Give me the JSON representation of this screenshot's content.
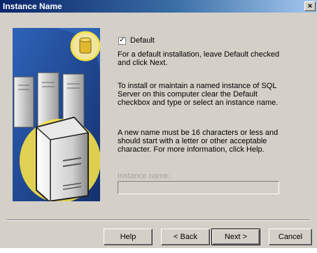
{
  "window": {
    "title": "Instance Name",
    "close_glyph": "×"
  },
  "default_checkbox": {
    "label": "Default",
    "checked": true,
    "check_glyph": "✓"
  },
  "paragraphs": {
    "default_install": "For a default installation, leave Default checked and click Next.",
    "named_instance": "To install or maintain a named instance of SQL Server on this computer clear the Default checkbox and type or select an instance name.",
    "name_rules": "A new name must be 16 characters or less and should start with a letter or other acceptable character.  For more information, click Help."
  },
  "instance_name": {
    "label": "Instance name:",
    "value": "",
    "disabled": true
  },
  "buttons": {
    "help": "Help",
    "back": "< Back",
    "next": "Next >",
    "cancel": "Cancel"
  },
  "colors": {
    "dialog_bg": "#d4d0c8",
    "title_gradient_start": "#0a246a",
    "title_gradient_end": "#a6caf0",
    "illustration_blue": "#1c3f8c",
    "highlight_yellow": "#f5e04a"
  }
}
